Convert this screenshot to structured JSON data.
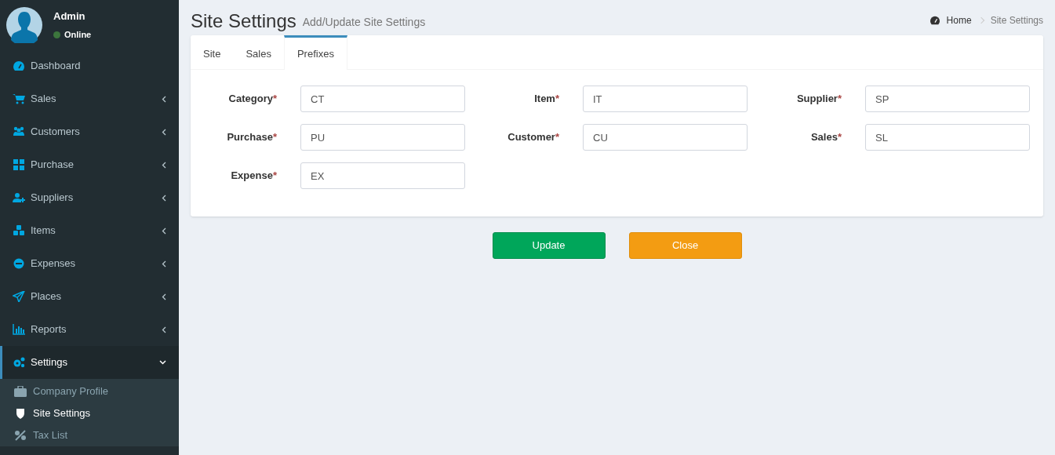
{
  "user": {
    "name": "Admin",
    "status": "Online"
  },
  "sidebar": {
    "items": [
      {
        "label": "Dashboard",
        "selected": false
      },
      {
        "label": "Sales",
        "expanded": false,
        "selected": false
      },
      {
        "label": "Customers",
        "expanded": false,
        "selected": false
      },
      {
        "label": "Purchase",
        "expanded": false,
        "selected": false
      },
      {
        "label": "Suppliers",
        "expanded": false,
        "selected": false
      },
      {
        "label": "Items",
        "expanded": false,
        "selected": false
      },
      {
        "label": "Expenses",
        "expanded": false,
        "selected": false
      },
      {
        "label": "Places",
        "expanded": false,
        "selected": false
      },
      {
        "label": "Reports",
        "expanded": false,
        "selected": false
      },
      {
        "label": "Settings",
        "expanded": true,
        "selected": true,
        "children": [
          {
            "label": "Company Profile",
            "selected": false
          },
          {
            "label": "Site Settings",
            "selected": true
          },
          {
            "label": "Tax List",
            "selected": false
          }
        ]
      }
    ]
  },
  "page": {
    "title": "Site Settings",
    "subtitle": "Add/Update Site Settings"
  },
  "breadcrumb": [
    {
      "label": "Home"
    },
    {
      "label": "Site Settings"
    }
  ],
  "tabs": [
    {
      "label": "Site",
      "selected": false
    },
    {
      "label": "Sales",
      "selected": false
    },
    {
      "label": "Prefixes",
      "selected": true
    }
  ],
  "fields": [
    {
      "label": "Category",
      "required_mark": "*",
      "value": "CT"
    },
    {
      "label": "Item",
      "required_mark": "*",
      "value": "IT"
    },
    {
      "label": "Supplier",
      "required_mark": "*",
      "value": "SP"
    },
    {
      "label": "Purchase",
      "required_mark": "*",
      "value": "PU"
    },
    {
      "label": "Customer",
      "required_mark": "*",
      "value": "CU"
    },
    {
      "label": "Sales",
      "required_mark": "*",
      "value": "SL"
    },
    {
      "label": "Expense",
      "required_mark": "*",
      "value": "EX"
    }
  ],
  "buttons": [
    {
      "label": "Update",
      "kind": "primary"
    },
    {
      "label": "Close",
      "kind": "warning"
    }
  ]
}
